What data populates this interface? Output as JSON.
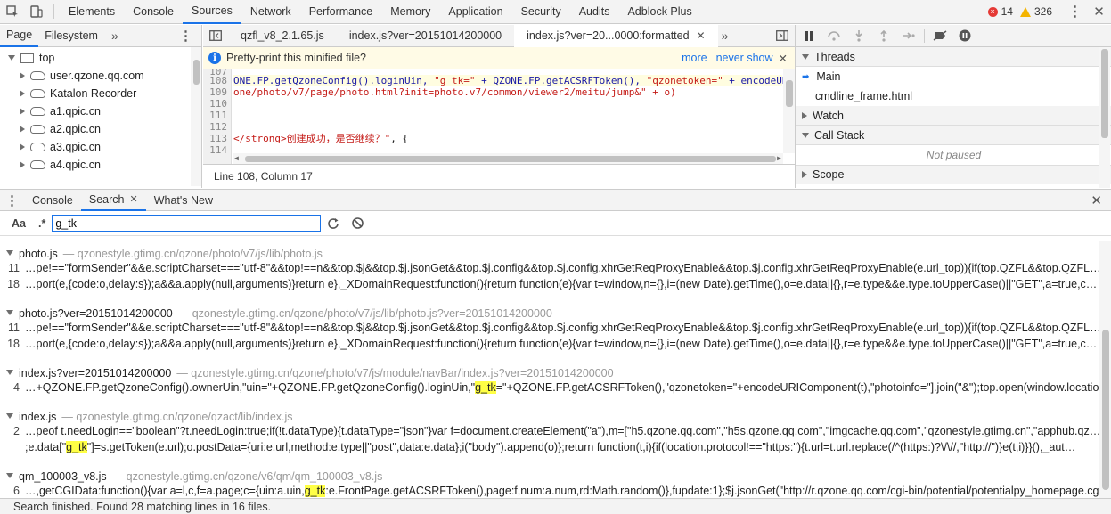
{
  "toolbar": {
    "tabs": [
      "Elements",
      "Console",
      "Sources",
      "Network",
      "Performance",
      "Memory",
      "Application",
      "Security",
      "Audits",
      "Adblock Plus"
    ],
    "error_count": "14",
    "warning_count": "326"
  },
  "navigator": {
    "tabs": [
      "Page",
      "Filesystem"
    ],
    "tree": [
      "top",
      "user.qzone.qq.com",
      "Katalon Recorder",
      "a1.qpic.cn",
      "a2.qpic.cn",
      "a3.qpic.cn",
      "a4.qpic.cn"
    ]
  },
  "editor": {
    "tabs": [
      "qzfl_v8_2.1.65.js",
      "index.js?ver=20151014200000",
      "index.js?ver=20...0000:formatted"
    ],
    "infobar_text": "Pretty-print this minified file?",
    "infobar_more": "more",
    "infobar_never": "never show",
    "line_numbers": [
      "107",
      "108",
      "109",
      "110",
      "111",
      "112",
      "113",
      "114"
    ],
    "lines": {
      "l108_a": "ONE.FP.getQzoneConfig().loginUin, ",
      "l108_b": "\"g_tk=\"",
      "l108_c": " + QZONE.FP.getACSRFToken(), ",
      "l108_d": "\"qzonetoken=\"",
      "l108_e": " + encodeUR",
      "l109": "one/photo/v7/page/photo.html?init=photo.v7/common/viewer2/meitu/jump&\" + o)",
      "l113_a": "</strong>创建成功，是否继续？\"",
      "l113_b": ", {"
    },
    "status": "Line 108, Column 17"
  },
  "debugger": {
    "sections": [
      "Threads",
      "Watch",
      "Call Stack",
      "Scope"
    ],
    "threads": [
      "Main",
      "cmdline_frame.html"
    ],
    "not_paused": "Not paused"
  },
  "drawer": {
    "tabs": [
      "Console",
      "Search",
      "What's New"
    ],
    "case_label": "Aa",
    "regex_label": ".*",
    "query": "g_tk"
  },
  "results": [
    {
      "file": "photo.js",
      "path": "— qzonestyle.gtimg.cn/qzone/photo/v7/js/lib/photo.js",
      "matches": [
        {
          "line": "11",
          "pre": "…pe!==\"formSender\"&&e.scriptCharset===\"utf-8\"&&top!==n&&top.$j&&top.$j.jsonGet&&top.$j.config&&top.$j.config.xhrGetReqProxyEnable&&top.$j.config.xhrGetReqProxyEnable(e.url_top)){if(top.QZFL&&top.QZFL…",
          "mark": "",
          "post": ""
        },
        {
          "line": "18",
          "pre": "…port(e,{code:o,delay:s});a&&a.apply(null,arguments)}return e},_XDomainRequest:function(){return function(e){var t=window,n={},i=(new Date).getTime(),o=e.data||{},r=e.type&&e.type.toUpperCase()||\"GET\",a=true,c…",
          "mark": "",
          "post": ""
        }
      ]
    },
    {
      "file": "photo.js?ver=20151014200000",
      "path": "— qzonestyle.gtimg.cn/qzone/photo/v7/js/lib/photo.js?ver=20151014200000",
      "matches": [
        {
          "line": "11",
          "pre": "…pe!==\"formSender\"&&e.scriptCharset===\"utf-8\"&&top!==n&&top.$j&&top.$j.jsonGet&&top.$j.config&&top.$j.config.xhrGetReqProxyEnable&&top.$j.config.xhrGetReqProxyEnable(e.url_top)){if(top.QZFL&&top.QZFL…",
          "mark": "",
          "post": ""
        },
        {
          "line": "18",
          "pre": "…port(e,{code:o,delay:s});a&&a.apply(null,arguments)}return e},_XDomainRequest:function(){return function(e){var t=window,n={},i=(new Date).getTime(),o=e.data||{},r=e.type&&e.type.toUpperCase()||\"GET\",a=true,c…",
          "mark": "",
          "post": ""
        }
      ]
    },
    {
      "file": "index.js?ver=20151014200000",
      "path": "— qzonestyle.gtimg.cn/qzone/photo/v7/js/module/navBar/index.js?ver=20151014200000",
      "matches": [
        {
          "line": "4",
          "pre": "…+QZONE.FP.getQzoneConfig().ownerUin,\"uin=\"+QZONE.FP.getQzoneConfig().loginUin,\"",
          "mark": "g_tk",
          "post": "=\"+QZONE.FP.getACSRFToken(),\"qzonetoken=\"+encodeURIComponent(t),\"photoinfo=\"].join(\"&\");top.open(window.locatio…"
        }
      ]
    },
    {
      "file": "index.js",
      "path": "— qzonestyle.gtimg.cn/qzone/qzact/lib/index.js",
      "matches": [
        {
          "line": "2",
          "pre": "…peof t.needLogin==\"boolean\"?t.needLogin:true;if(!t.dataType){t.dataType=\"json\"}var f=document.createElement(\"a\"),m=[\"h5.qzone.qq.com\",\"h5s.qzone.qq.com\",\"imgcache.qq.com\",\"qzonestyle.gtimg.cn\",\"apphub.qz…",
          "mark": "",
          "post": ""
        },
        {
          "line": "",
          "pre": ";e.data[\"",
          "mark": "g_tk",
          "post": "\"]=s.getToken(e.url);o.postData={uri:e.url,method:e.type||\"post\",data:e.data};i(\"body\").append(o)};return function(t,i){if(location.protocol!==\"https:\"){t.url=t.url.replace(/^(https:)?\\/\\//,\"http://\")}e(t,i)}}(),_aut…"
        }
      ]
    },
    {
      "file": "qm_100003_v8.js",
      "path": "— qzonestyle.gtimg.cn/qzone/v6/qm/qm_100003_v8.js",
      "matches": [
        {
          "line": "6",
          "pre": "…,getCGIData:function(){var a=l,c,f=a.page;c={uin:a.uin,",
          "mark": "g_tk",
          "post": ":e.FrontPage.getACSRFToken(),page:f,num:a.num,rd:Math.random()},fupdate:1};$j.jsonGet(\"http://r.qzone.qq.com/cgi-bin/potential/potentialpy_homepage.cgi…"
        }
      ]
    }
  ],
  "status": "Search finished.  Found 28 matching lines in 16 files."
}
